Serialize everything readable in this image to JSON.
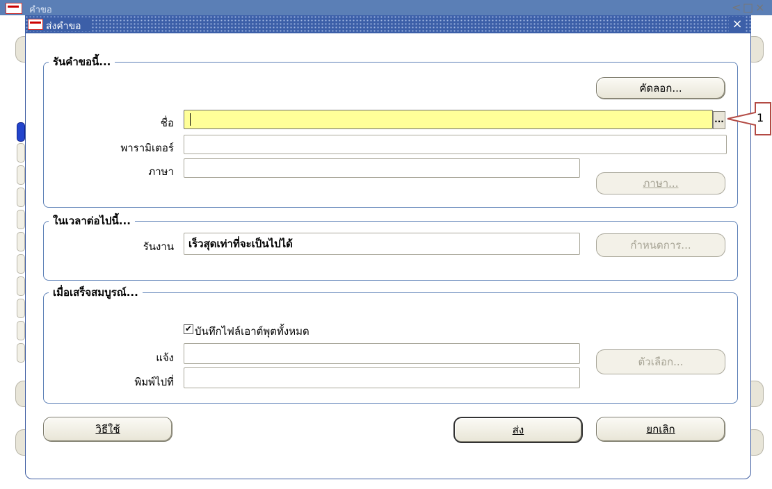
{
  "background_window": {
    "title": "คำขอ",
    "controls": [
      "<",
      "-",
      "□",
      "×"
    ]
  },
  "dialog": {
    "title": "ส่งคำขอ",
    "close_icon": "close-icon",
    "group_run": {
      "label": "รันคำขอนี้...",
      "copy_button": "คัดลอก...",
      "name_label": "ชื่อ",
      "name_value": "",
      "lov_label": "...",
      "params_label": "พารามิเตอร์",
      "params_value": "",
      "language_label": "ภาษา",
      "language_value": "",
      "language_button": "ภาษา..."
    },
    "group_schedule": {
      "label": "ในเวลาต่อไปนี้...",
      "run_job_label": "รันงาน",
      "run_job_value": "เร็วสุดเท่าที่จะเป็นไปได้",
      "schedule_button": "กำหนดการ..."
    },
    "group_completion": {
      "label": "เมื่อเสร็จสมบูรณ์...",
      "save_output_checked": true,
      "save_output_label": "บันทึกไฟล์เอาต์พุตทั้งหมด",
      "notify_label": "แจ้ง",
      "notify_value": "",
      "print_to_label": "พิมพ์ไปที่",
      "print_to_value": "",
      "options_button": "ตัวเลือก..."
    },
    "help_button": "วิธีใช้",
    "submit_button": "ส่ง",
    "cancel_button": "ยกเลิก"
  },
  "callout": {
    "number": "1",
    "border_color": "#b34a44"
  },
  "colors": {
    "titlebar": "#3c5fa8",
    "active_field": "#ffff99",
    "group_border": "#5b7fb6"
  }
}
